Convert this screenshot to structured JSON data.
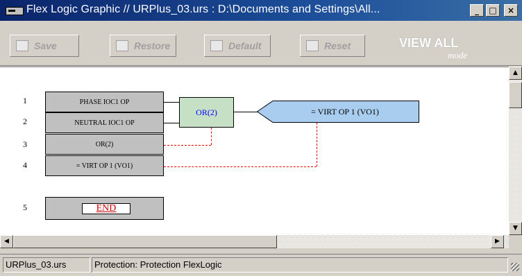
{
  "window": {
    "title": "Flex Logic Graphic // URPlus_03.urs : D:\\Documents and Settings\\All...",
    "minimize_glyph": "_",
    "maximize_glyph": "□",
    "close_glyph": "×"
  },
  "toolbar": {
    "save_label": "Save",
    "restore_label": "Restore",
    "default_label": "Default",
    "reset_label": "Reset",
    "view_all": "VIEW ALL",
    "view_mode": "mode"
  },
  "diagram": {
    "rows": [
      {
        "num": "1",
        "label": "PHASE IOC1 OP"
      },
      {
        "num": "2",
        "label": "NEUTRAL IOC1 OP"
      },
      {
        "num": "3",
        "label": "OR(2)"
      },
      {
        "num": "4",
        "label": "= VIRT OP 1 (VO1)"
      },
      {
        "num": "5",
        "label": "END"
      }
    ],
    "gate_label": "OR(2)",
    "output_label": "= VIRT OP 1 (VO1)"
  },
  "scrollbars": {
    "up_arrow": "▲",
    "down_arrow": "▼",
    "left_arrow": "◀",
    "right_arrow": "▶"
  },
  "status": {
    "file": "URPlus_03.urs",
    "context": "Protection: Protection FlexLogic"
  }
}
